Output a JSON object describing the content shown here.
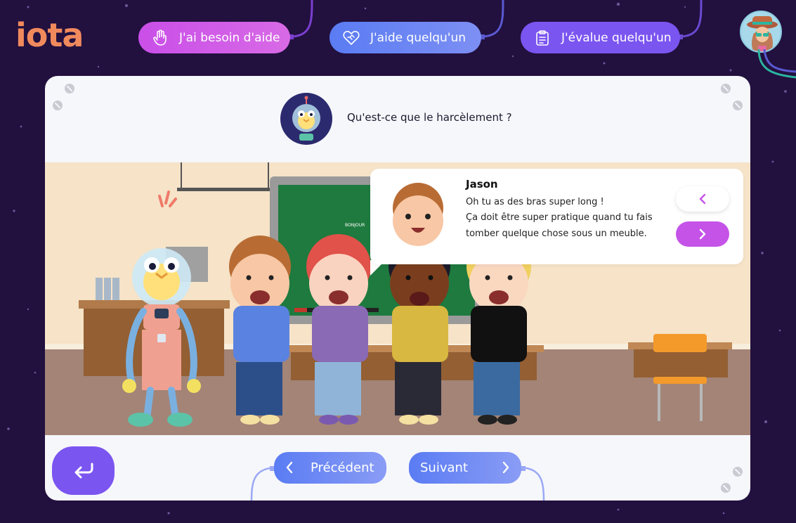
{
  "app": {
    "logo": "iota"
  },
  "header": {
    "help_button": "J'ai besoin d'aide",
    "helping_button": "J'aide quelqu'un",
    "evaluate_button": "J'évalue quelqu'un"
  },
  "question": "Qu'est-ce que le harcèlement ?",
  "scene": {
    "board_text": "BONJOUR"
  },
  "dialogue": {
    "speaker": "Jason",
    "lines": [
      "Oh tu as des bras super long !",
      "Ça doit être super pratique quand tu fais",
      "tomber quelque chose sous un meuble."
    ]
  },
  "footer": {
    "previous": "Précédent",
    "next": "Suivant"
  },
  "colors": {
    "background": "#22103f",
    "logo": "#f08a5d",
    "help": "#c94fe8",
    "helping": "#5a7cf3",
    "evaluate": "#7b55f0",
    "dialogue_next": "#c553e8"
  },
  "icons": {
    "help": "hand-icon",
    "helping": "heart-hand-icon",
    "evaluate": "clipboard-icon",
    "back": "return-arrow-icon",
    "previous": "chevron-left-icon",
    "next": "chevron-right-icon"
  }
}
